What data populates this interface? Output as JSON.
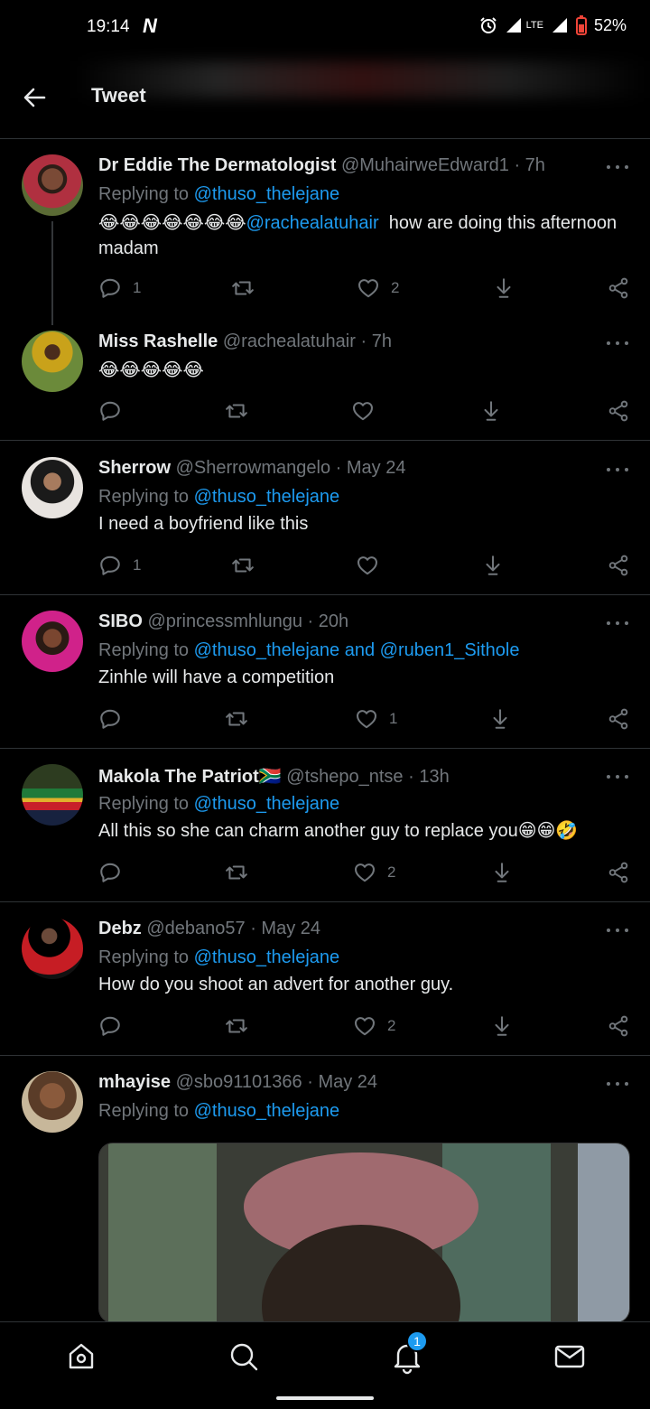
{
  "status_bar": {
    "time": "19:14",
    "carrier_logo": "N",
    "network": "LTE",
    "battery": "52%",
    "icons": [
      "alarm-icon",
      "signal-icon",
      "lte-icon",
      "signal-icon",
      "battery-saver-icon"
    ]
  },
  "header": {
    "title": "Tweet",
    "back_icon": "arrow-left-icon"
  },
  "tweets": [
    {
      "name": "Dr Eddie The Dermatologist",
      "handle": "@MuhairweEdward1",
      "time": "· 7h",
      "replying_prefix": "Replying to",
      "replying_to": "@thuso_thelejane",
      "emoji_prefix": "😂😂😂😂😂😂😂",
      "mention": "@rachealatuhair",
      "text": "how are doing this afternoon madam",
      "replies": "1",
      "retweets": "",
      "likes": "2"
    },
    {
      "name": "Miss Rashelle",
      "handle": "@rachealatuhair",
      "time": "· 7h",
      "text": "😂😂😂😂😂",
      "replies": "",
      "retweets": "",
      "likes": ""
    },
    {
      "name": "Sherrow",
      "handle": "@Sherrowmangelo",
      "time": "· May 24",
      "replying_prefix": "Replying to",
      "replying_to": "@thuso_thelejane",
      "text": "I need a boyfriend like this",
      "replies": "1",
      "retweets": "",
      "likes": ""
    },
    {
      "name": "SIBO",
      "handle": "@princessmhlungu",
      "time": "· 20h",
      "replying_prefix": "Replying to",
      "replying_to": "@thuso_thelejane and @ruben1_Sithole",
      "text": "Zinhle will have a competition",
      "replies": "",
      "retweets": "",
      "likes": "1"
    },
    {
      "name": "Makola The Patriot",
      "name_emoji": "🇿🇦",
      "handle": "@tshepo_ntse",
      "time": "· 13h",
      "replying_prefix": "Replying to",
      "replying_to": "@thuso_thelejane",
      "text": "All this so she can charm another guy to replace you",
      "text_emoji": "😁😁🤣",
      "replies": "",
      "retweets": "",
      "likes": "2"
    },
    {
      "name": "Debz",
      "handle": "@debano57",
      "time": "· May 24",
      "replying_prefix": "Replying to",
      "replying_to": "@thuso_thelejane",
      "text": "How do you shoot an advert for another guy.",
      "replies": "",
      "retweets": "",
      "likes": "2"
    },
    {
      "name": "mhayise",
      "handle": "@sbo91101366",
      "time": "· May 24",
      "replying_prefix": "Replying to",
      "replying_to": "@thuso_thelejane"
    }
  ],
  "bottom_nav": {
    "items": [
      "home-icon",
      "search-icon",
      "notifications-icon",
      "messages-icon"
    ],
    "notification_count": "1"
  },
  "colors": {
    "background": "#000000",
    "text": "#e7e9ea",
    "muted": "#71767b",
    "link": "#1d9bf0",
    "divider": "#2f3336"
  }
}
